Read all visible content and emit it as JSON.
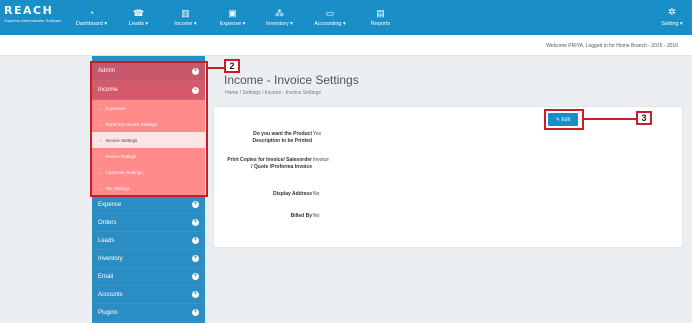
{
  "brand": {
    "logo": "REACH",
    "tagline": "Supreme Administrator Software"
  },
  "nav": [
    {
      "label": "Dashboard ▾",
      "icon": "speedometer-icon",
      "glyph": "◔"
    },
    {
      "label": "Leads ▾",
      "icon": "phone-icon",
      "glyph": "☎"
    },
    {
      "label": "Income ▾",
      "icon": "bar-chart-icon",
      "glyph": "▥"
    },
    {
      "label": "Expense ▾",
      "icon": "money-icon",
      "glyph": "▣"
    },
    {
      "label": "Inventory ▾",
      "icon": "cubes-icon",
      "glyph": "⁂"
    },
    {
      "label": "Accounting ▾",
      "icon": "monitor-icon",
      "glyph": "▭"
    },
    {
      "label": "Reports",
      "icon": "document-icon",
      "glyph": "▤"
    }
  ],
  "settings": {
    "label": "Setting ▾",
    "icon": "gear-icon",
    "glyph": "✲"
  },
  "welcome": "Welcome PRIYA, Logged in for Home Branch - 2015 - 2016",
  "sidebar": {
    "top": [
      {
        "label": "Admin"
      },
      {
        "label": "Income"
      }
    ],
    "income_subitems": [
      "Expenses",
      "Performa Invoice Settings",
      "Invoice Settings",
      "Invoice Ratings",
      "Customer Settings",
      "Tax Settings"
    ],
    "bottom": [
      {
        "label": "Expense"
      },
      {
        "label": "Orders"
      },
      {
        "label": "Leads"
      },
      {
        "label": "Inventory"
      },
      {
        "label": "Email"
      },
      {
        "label": "Accounts"
      },
      {
        "label": "Plugins"
      }
    ]
  },
  "page": {
    "title": "Income - Invoice Settings",
    "breadcrumb": "Home / Settings / Income - Invoice Settings",
    "edit_label": "✎ Edit"
  },
  "fields": [
    {
      "label": "Do you want the Product Description to be Printed",
      "value": "Yes"
    },
    {
      "label": "Print Copies for Invoice/ Salesorder / Quote /Proforma Invoice",
      "value": "Invoice"
    },
    {
      "label": "Display Address",
      "value": "No"
    },
    {
      "label": "Billed By",
      "value": "No"
    }
  ],
  "callouts": {
    "sidebar": "2",
    "edit": "3"
  },
  "colors": {
    "nav": "#1a8fc7",
    "highlight": "#c41f2a",
    "sub_menu": "#ff8b8b"
  }
}
